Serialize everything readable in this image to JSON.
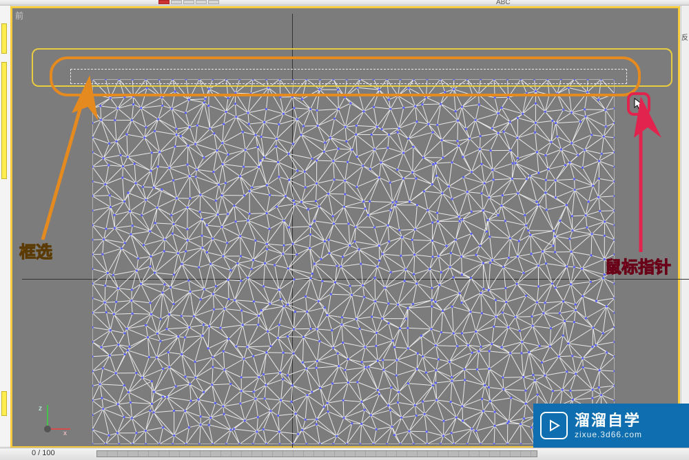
{
  "viewport": {
    "label": "前",
    "outline_color": "#f6cc3d",
    "background": "#7c7c7c"
  },
  "toolbar": {
    "text_hint": "ABC"
  },
  "right_panel": {
    "hint": "反"
  },
  "annotations": {
    "box_select_label": "框选",
    "cursor_label": "鼠标指针",
    "orange_color": "#e58a1f",
    "pink_color": "#e2234e",
    "yellow_color": "#e9cc3f"
  },
  "selection_marquee": {
    "style": "dashed",
    "description": "Rectangular marquee selection across top row of vertices"
  },
  "mesh": {
    "type": "triangulated plane (vertex sub-object mode)",
    "approx_cols": 40,
    "approx_rows": 26,
    "vertex_color": "#5a60ff",
    "edge_color": "#eaeaea"
  },
  "gizmo": {
    "vertical_axis": "z",
    "horizontal_axis": "x"
  },
  "timeline": {
    "frame_display": "0 / 100"
  },
  "badge": {
    "title": "溜溜自学",
    "subtitle": "zixue.3d66.com"
  }
}
